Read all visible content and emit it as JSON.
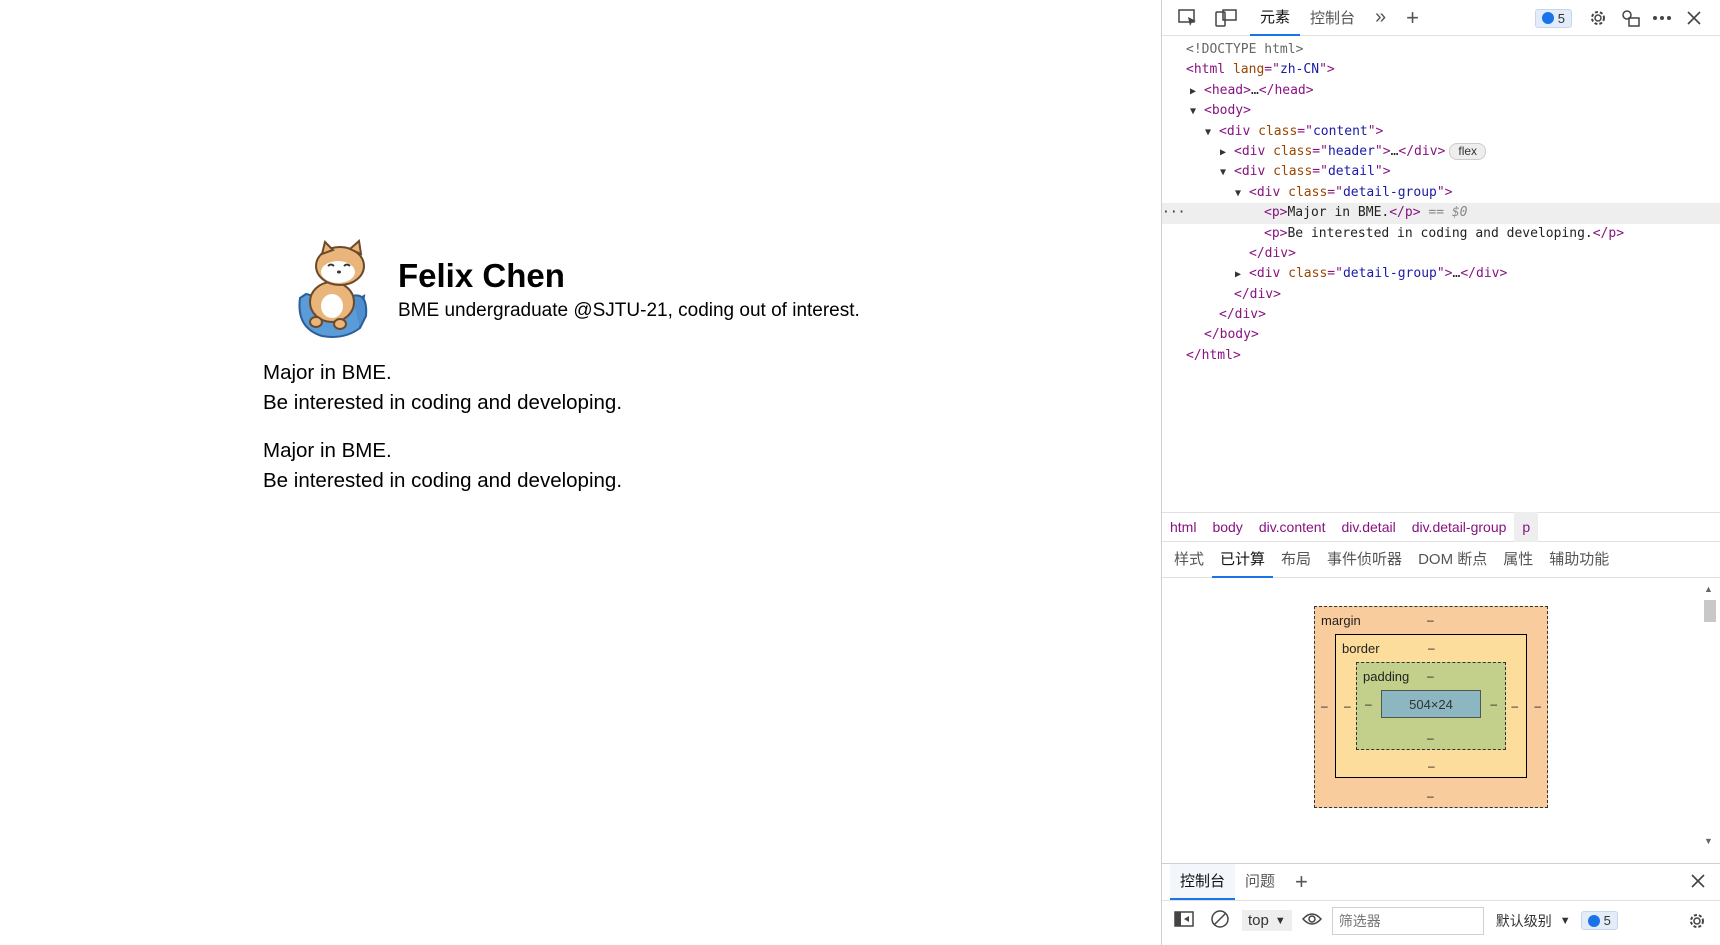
{
  "page": {
    "header": {
      "name": "Felix Chen",
      "bio": "BME undergraduate @SJTU-21, coding out of interest."
    },
    "detail_groups": [
      {
        "lines": [
          "Major in BME.",
          "Be interested in coding and developing."
        ]
      },
      {
        "lines": [
          "Major in BME.",
          "Be interested in coding and developing."
        ]
      }
    ]
  },
  "devtools": {
    "toolbar": {
      "tabs": [
        "元素",
        "控制台"
      ],
      "active_tab": "元素",
      "more": "»",
      "add": "+",
      "messages_count": "5",
      "icons": [
        "inspect-icon",
        "device-toolbar-icon",
        "gear-icon",
        "dock-icon",
        "more-icon",
        "close-icon"
      ]
    },
    "dom_tree": {
      "doctype": "<!DOCTYPE html>",
      "html_open": {
        "tag": "html",
        "attr": "lang",
        "value": "zh-CN"
      },
      "head": {
        "tag": "head",
        "ellipsis": "…"
      },
      "body_tag": "body",
      "content": {
        "tag": "div",
        "attr": "class",
        "value": "content"
      },
      "header": {
        "tag": "div",
        "attr": "class",
        "value": "header",
        "ellipsis": "…",
        "badge": "flex"
      },
      "detail": {
        "tag": "div",
        "attr": "class",
        "value": "detail"
      },
      "detail_group": {
        "tag": "div",
        "attr": "class",
        "value": "detail-group"
      },
      "p1_text": "Major in BME.",
      "p2_text": "Be interested in coding and developing.",
      "selected_marker": "== $0",
      "dots": "···",
      "detail_group_collapsed": {
        "tag": "div",
        "attr": "class",
        "value": "detail-group",
        "ellipsis": "…"
      }
    },
    "breadcrumb": [
      "html",
      "body",
      "div.content",
      "div.detail",
      "div.detail-group",
      "p"
    ],
    "subtabs": [
      "样式",
      "已计算",
      "布局",
      "事件侦听器",
      "DOM 断点",
      "属性",
      "辅助功能"
    ],
    "active_subtab": "已计算",
    "box_model": {
      "margin_label": "margin",
      "border_label": "border",
      "padding_label": "padding",
      "content_size": "504×24",
      "placeholder": "–"
    },
    "drawer": {
      "tabs": [
        "控制台",
        "问题"
      ],
      "active_tab": "控制台",
      "add": "+",
      "context": "top",
      "filter_placeholder": "筛选器",
      "levels": "默认级别",
      "messages_count": "5"
    },
    "colors": {
      "accent": "#1a73e8",
      "tag": "#881280",
      "attr": "#994500",
      "value": "#1a1aa6"
    }
  }
}
